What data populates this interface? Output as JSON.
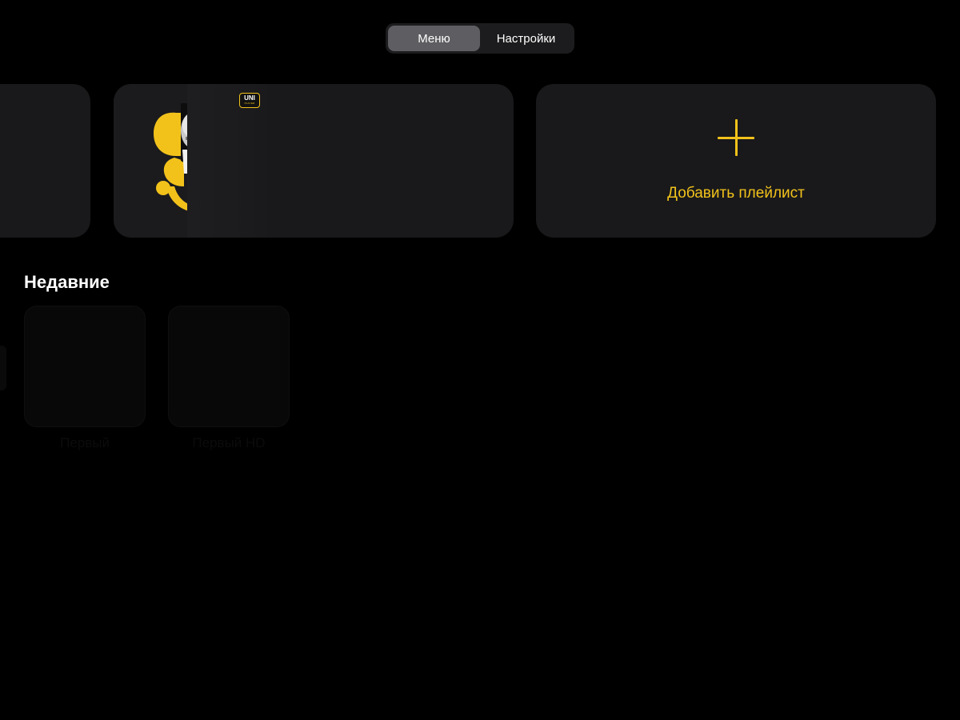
{
  "segmented": {
    "items": [
      {
        "label": "Меню",
        "active": true
      },
      {
        "label": "Настройки",
        "active": false
      }
    ]
  },
  "playlists": {
    "badge_brand": "UNI",
    "badge_sub": "PLAYER",
    "add_label": "Добавить плейлист"
  },
  "recent": {
    "title": "Недавние",
    "items": [
      {
        "label": "Первый"
      },
      {
        "label": "Первый HD"
      }
    ]
  },
  "colors": {
    "background": "#000000",
    "card": "#19191b",
    "accent": "#f2c21b",
    "segment_active": "#5e5e62"
  },
  "icons": [
    "plus-icon",
    "uni-player-badge-icon",
    "playlist-cover-logo"
  ]
}
